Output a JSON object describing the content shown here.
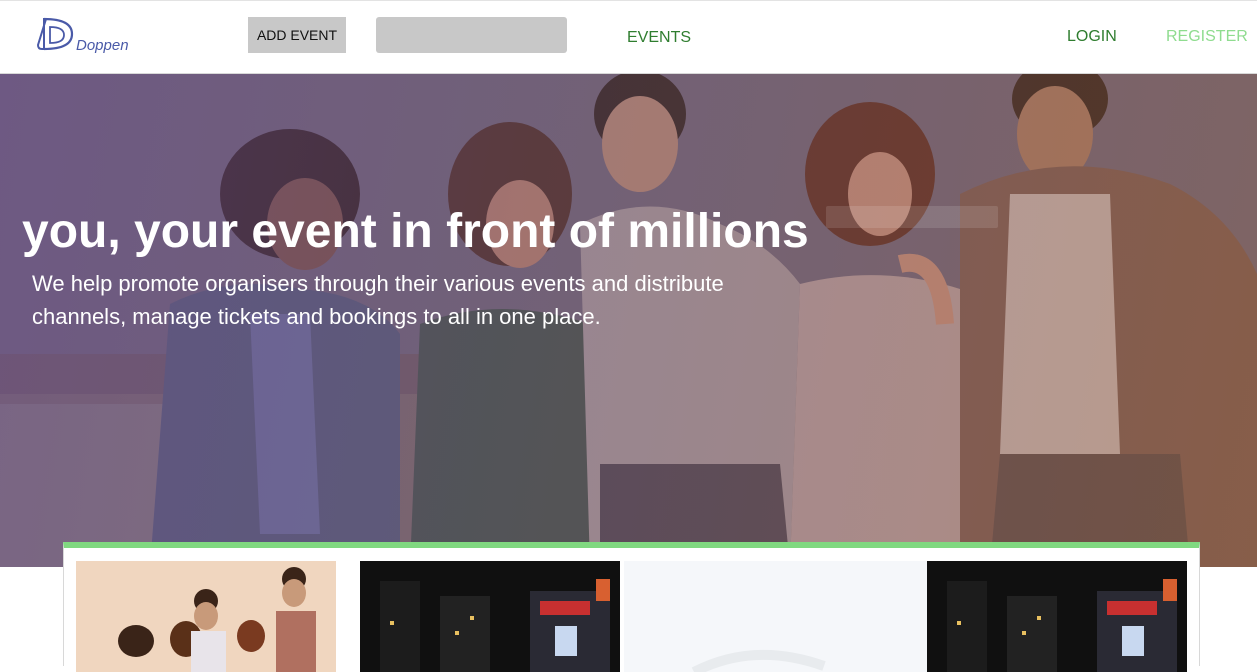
{
  "navbar": {
    "logo_text": "Doppen",
    "add_event_label": "ADD EVENT",
    "search_value": "",
    "events_label": "EVENTS",
    "login_label": "LOGIN",
    "register_label": "REGISTER"
  },
  "hero": {
    "title": "you, your event in front of millions",
    "subtitle": "We help promote organisers through their various events and distribute channels, manage tickets and bookings to all in one place."
  },
  "cards": [
    {
      "name": "event-card-friends"
    },
    {
      "name": "event-card-city-night"
    },
    {
      "name": "event-card-placeholder"
    },
    {
      "name": "event-card-city-night-2"
    }
  ],
  "colors": {
    "nav_link": "#2f7d2f",
    "register": "#8fdc8f",
    "accent_strip": "#80d880",
    "button_bg": "#c8c8c8"
  }
}
